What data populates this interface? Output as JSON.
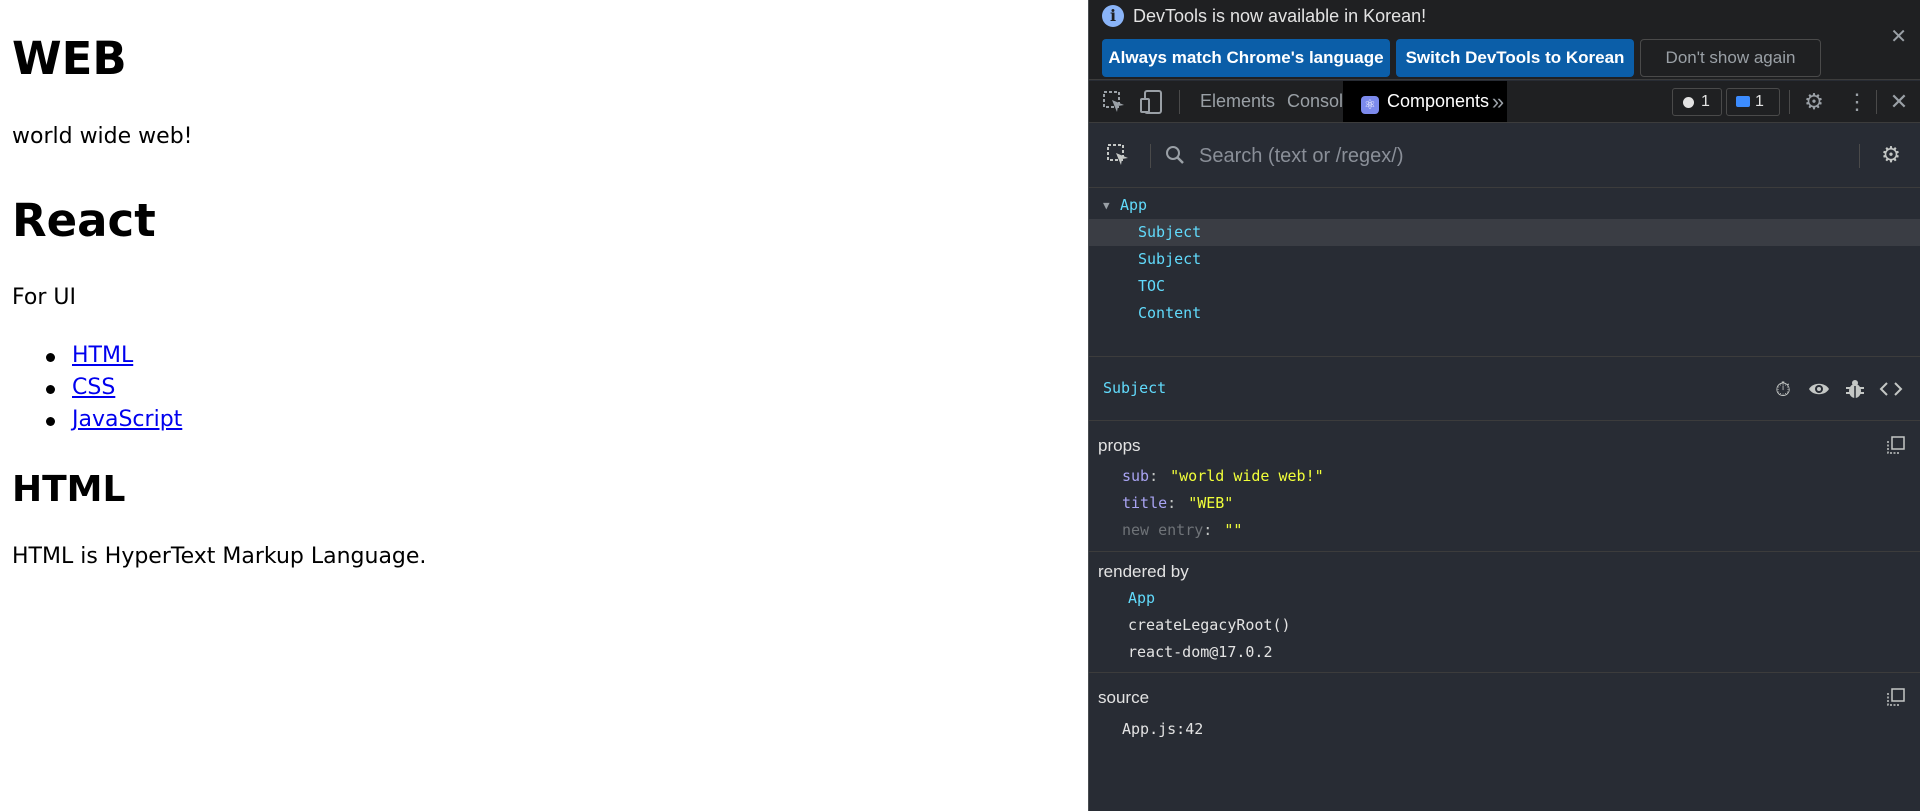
{
  "page": {
    "web_title": "WEB",
    "web_sub": "world wide web!",
    "react_title": "React",
    "react_sub": "For UI",
    "toc_links": [
      "HTML",
      "CSS",
      "JavaScript"
    ],
    "content_title": "HTML",
    "content_desc": "HTML is HyperText Markup Language."
  },
  "devtools": {
    "infobar": {
      "message": "DevTools is now available in Korean!",
      "buttons": [
        "Always match Chrome's language",
        "Switch DevTools to Korean",
        "Don't show again"
      ],
      "close_icon": "close-icon"
    },
    "tabs": [
      "Elements",
      "Console",
      "Components"
    ],
    "more_tabs": "»",
    "error_count": "1",
    "message_count": "1",
    "search_placeholder": "Search (text or /regex/)",
    "tree": {
      "root": "App",
      "children": [
        "Subject",
        "Subject",
        "TOC",
        "Content"
      ],
      "selected_index": 0
    },
    "selected_component": "Subject",
    "props_title": "props",
    "props": [
      {
        "key": "sub",
        "value": "\"world wide web!\""
      },
      {
        "key": "title",
        "value": "\"WEB\""
      }
    ],
    "new_entry": {
      "key": "new entry",
      "value": "\"\""
    },
    "rendered_by_title": "rendered by",
    "rendered_by": [
      "App",
      "createLegacyRoot()",
      "react-dom@17.0.2"
    ],
    "source_title": "source",
    "source": "App.js:42"
  },
  "colors": {
    "devtools_bg": "#282c34",
    "component_name": "#61dafb",
    "prop_key": "#a9a4f3",
    "prop_value": "#f1ff3a",
    "link": "#0000ee",
    "primary_button": "#0b5ea8"
  }
}
